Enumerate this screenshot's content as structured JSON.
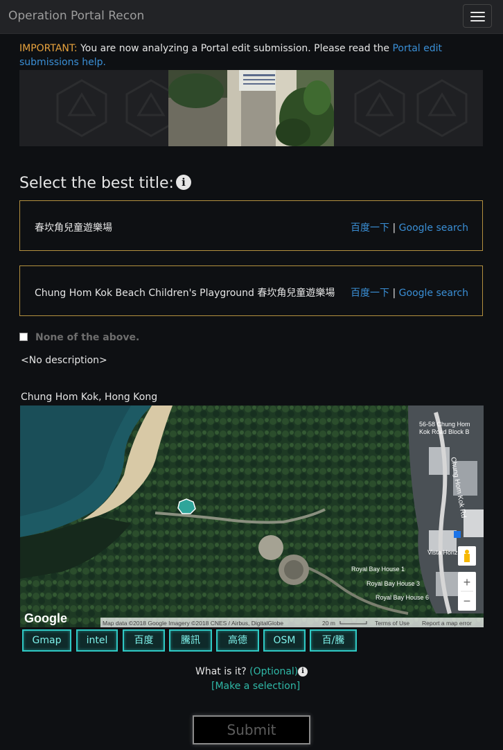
{
  "navbar": {
    "brand": "Operation Portal Recon"
  },
  "notice": {
    "important_label": "IMPORTANT:",
    "text": " You are now analyzing a Portal edit submission. Please read the ",
    "link_text": "Portal edit submissions help."
  },
  "title_section": {
    "heading": "Select the best title:",
    "options": [
      {
        "text": "春坎角兒童遊樂場",
        "link_baidu": "百度一下",
        "separator": " | ",
        "link_google": "Google search"
      },
      {
        "text": "Chung Hom Kok Beach Children's Playground 春坎角兒童遊樂場",
        "link_baidu": "百度一下",
        "separator": " | ",
        "link_google": "Google search"
      }
    ],
    "none_label": "None of the above."
  },
  "description": "<No description>",
  "location": "Chung Hom Kok, Hong Kong",
  "map": {
    "labels": {
      "building_top": "56-58 Chung Hom",
      "building_top2": "Kok Road Block B",
      "road": "Chung Hom Kok Rd",
      "vista": "Vista Horiz",
      "rbh1": "Royal Bay House 1",
      "rbh3": "Royal Bay House 3",
      "rbh6": "Royal Bay House 6"
    },
    "google_logo": "Google",
    "footer": {
      "data": "Map data ©2018 Google Imagery ©2018 CNES / Airbus, DigitalGlobe",
      "scale": "20 m",
      "terms": "Terms of Use",
      "report": "Report a map error"
    },
    "zoom_in": "+",
    "zoom_out": "−"
  },
  "map_buttons": [
    "Gmap",
    "intel",
    "百度",
    "騰訊",
    "高德",
    "OSM",
    "百/騰"
  ],
  "whatis": {
    "label": "What is it? ",
    "optional": "(Optional)",
    "make_selection": "[Make a selection]"
  },
  "submit_label": "Submit",
  "colors": {
    "accent": "#2fc9c4",
    "gold_border": "#b5913f",
    "link": "#3a8fd6",
    "important": "#e8a33d"
  }
}
